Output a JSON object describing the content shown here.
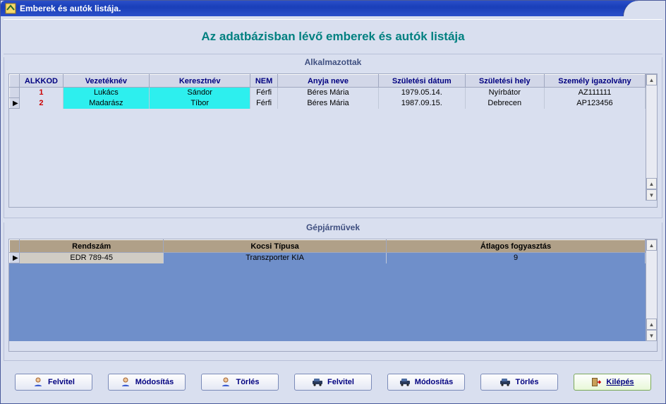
{
  "window": {
    "title": "Emberek és autók listája."
  },
  "header": {
    "main_title": "Az adatbázisban lévő emberek és autók listája"
  },
  "employees": {
    "group_label": "Alkalmazottak",
    "columns": {
      "c1": "ALKKOD",
      "c2": "Vezetéknév",
      "c3": "Keresztnév",
      "c4": "NEM",
      "c5": "Anyja neve",
      "c6": "Születési dátum",
      "c7": "Születési hely",
      "c8": "Személy igazolvány"
    },
    "rows": [
      {
        "kod": "1",
        "vez": "Lukács",
        "ker": "Sándor",
        "nem": "Férfi",
        "anya": "Béres Mária",
        "szul_d": "1979.05.14.",
        "szul_h": "Nyírbátor",
        "szig": "AZ111111"
      },
      {
        "kod": "2",
        "vez": "Madarász",
        "ker": "Tíbor",
        "nem": "Férfi",
        "anya": "Béres Mária",
        "szul_d": "1987.09.15.",
        "szul_h": "Debrecen",
        "szig": "AP123456"
      }
    ],
    "current_row_marker": "▶"
  },
  "vehicles": {
    "group_label": "Gépjárművek",
    "columns": {
      "c1": "Rendszám",
      "c2": "Kocsi Típusa",
      "c3": "Átlagos fogyasztás"
    },
    "rows": [
      {
        "rendsz": "EDR 789-45",
        "tipus": "Transzporter KIA",
        "fogy": "9"
      }
    ],
    "current_row_marker": "▶"
  },
  "buttons": {
    "emp_add": "Felvitel",
    "emp_edit": "Módosítás",
    "emp_del": "Törlés",
    "veh_add": "Felvitel",
    "veh_edit": "Módosítás",
    "veh_del": "Törlés",
    "exit": "Kilépés"
  }
}
